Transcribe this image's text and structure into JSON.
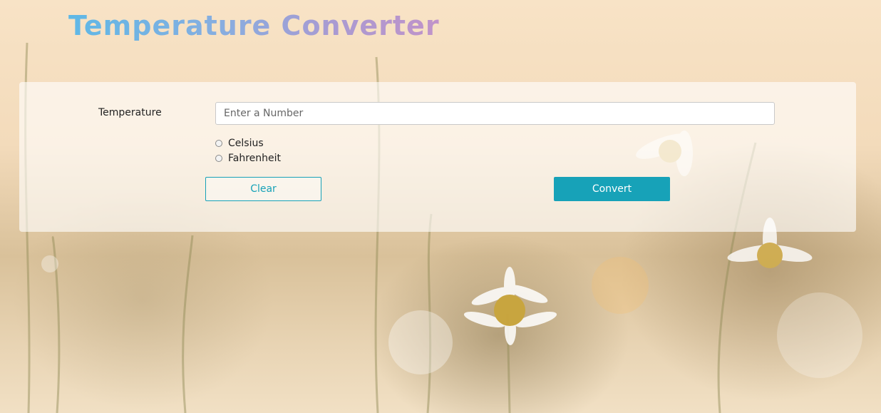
{
  "header": {
    "title": "Temperature Converter"
  },
  "form": {
    "temperature_label": "Temperature",
    "temperature_placeholder": "Enter a Number",
    "temperature_value": "",
    "units": [
      {
        "label": "Celsius",
        "selected": false
      },
      {
        "label": "Fahrenheit",
        "selected": false
      }
    ],
    "clear_label": "Clear",
    "convert_label": "Convert"
  },
  "colors": {
    "accent": "#17a2b8",
    "title_gradient_start": "#5fb8e6",
    "title_gradient_end": "#c193c9"
  }
}
